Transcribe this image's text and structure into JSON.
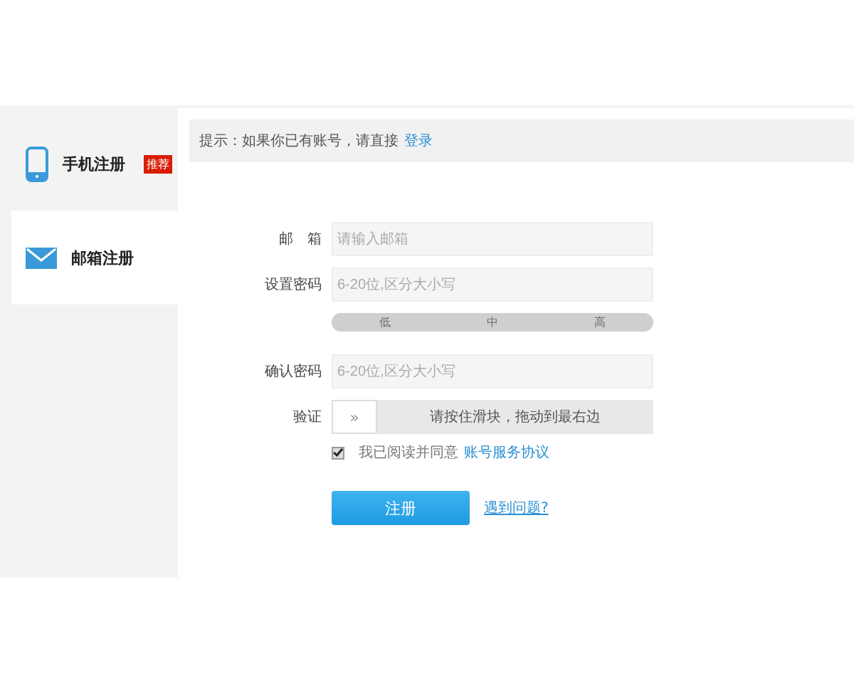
{
  "sidebar": {
    "tabs": [
      {
        "label": "手机注册",
        "kind": "phone",
        "badge": "推荐",
        "selected": false
      },
      {
        "label": "邮箱注册",
        "kind": "mail",
        "selected": true
      }
    ]
  },
  "hint": {
    "text": "提示：如果你已有账号，请直接",
    "link": "登录"
  },
  "form": {
    "fields": [
      {
        "kind": "input",
        "label": "邮　箱",
        "placeholder": "请输入邮箱"
      },
      {
        "kind": "input",
        "label": "设置密码",
        "placeholder": "6-20位,区分大小写"
      },
      {
        "kind": "strength",
        "segments": [
          "低",
          "中",
          "高"
        ]
      },
      {
        "kind": "input",
        "label": "确认密码",
        "placeholder": "6-20位,区分大小写"
      },
      {
        "kind": "slider",
        "label": "验证",
        "handle": "»",
        "level": 0,
        "text": "请按住滑块，拖动到最右边"
      }
    ],
    "agreement": {
      "checked": true,
      "text": "我已阅读并同意",
      "link": "账号服务协议"
    },
    "submit": "注册",
    "help_link": "遇到问题?"
  }
}
